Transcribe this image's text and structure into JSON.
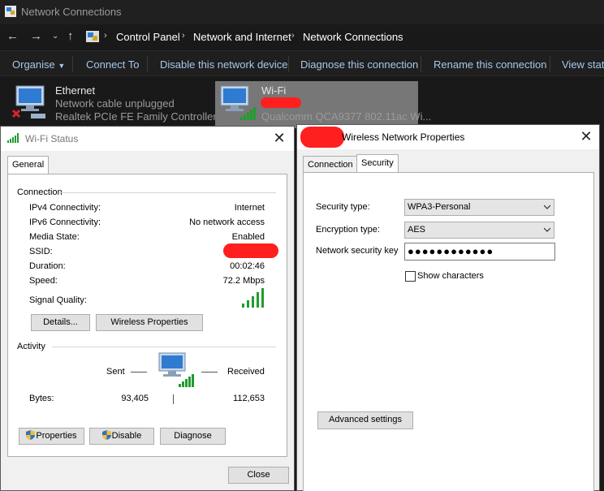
{
  "window": {
    "title": "Network Connections"
  },
  "address": {
    "crumbs": [
      "Control Panel",
      "Network and Internet",
      "Network Connections"
    ]
  },
  "commands": [
    "Organise",
    "Connect To",
    "Disable this network device",
    "Diagnose this connection",
    "Rename this connection",
    "View statu"
  ],
  "connections": [
    {
      "name": "Ethernet",
      "status": "Network cable unplugged",
      "adapter": "Realtek PCIe FE Family Controller"
    },
    {
      "name": "Wi-Fi",
      "adapter": "Qualcomm QCA9377 802.11ac Wi..."
    }
  ],
  "status_dialog": {
    "title": "Wi-Fi Status",
    "tab": "General",
    "connection_heading": "Connection",
    "rows": [
      {
        "label": "IPv4 Connectivity:",
        "value": "Internet"
      },
      {
        "label": "IPv6 Connectivity:",
        "value": "No network access"
      },
      {
        "label": "Media State:",
        "value": "Enabled"
      },
      {
        "label": "SSID:",
        "value": ""
      },
      {
        "label": "Duration:",
        "value": "00:02:46"
      },
      {
        "label": "Speed:",
        "value": "72.2 Mbps"
      }
    ],
    "signal_label": "Signal Quality:",
    "signal_bars": 5,
    "details_button": "Details...",
    "wireless_button": "Wireless Properties",
    "activity_heading": "Activity",
    "sent_label": "Sent",
    "received_label": "Received",
    "bytes_label": "Bytes:",
    "bytes_sent": "93,405",
    "bytes_received": "112,653",
    "properties_button": "Properties",
    "disable_button": "Disable",
    "diagnose_button": "Diagnose",
    "close_button": "Close"
  },
  "props_dialog": {
    "title": "Wireless Network Properties",
    "tabs": [
      "Connection",
      "Security"
    ],
    "security_type_label": "Security type:",
    "security_type": "WPA3-Personal",
    "encryption_type_label": "Encryption type:",
    "encryption_type": "AES",
    "key_label": "Network security key",
    "key_mask": "●●●●●●●●●●●●",
    "show_characters": "Show characters",
    "advanced_button": "Advanced settings"
  },
  "colors": {
    "accent_link": "#a6c8ea",
    "signal_green": "#1f9d2e",
    "redaction": "#ff1f1f"
  }
}
